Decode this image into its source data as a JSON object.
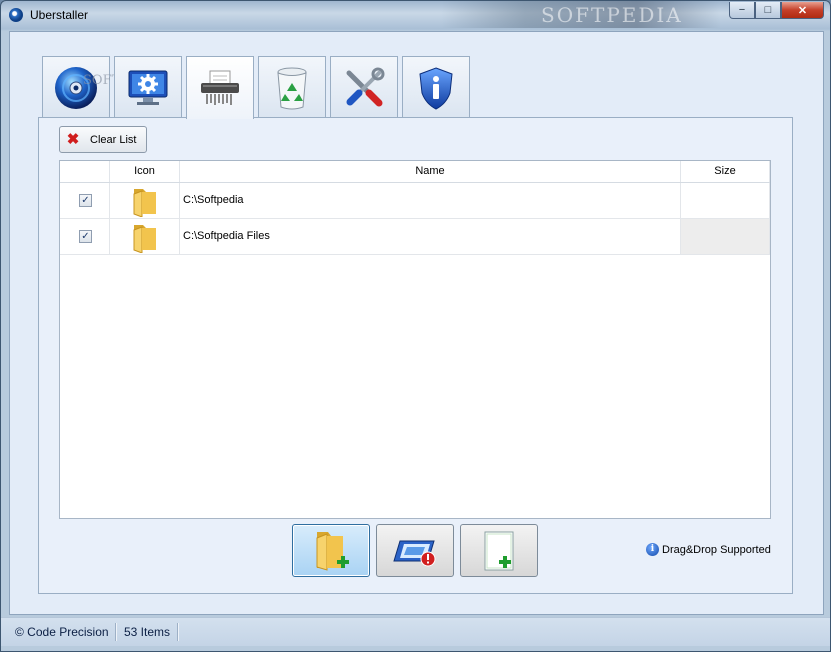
{
  "window": {
    "title": "Uberstaller",
    "watermark": "SOFTPEDIA",
    "tab_watermark": "SOFTPEDIA"
  },
  "caption_buttons": {
    "minimize": "−",
    "maximize": "□",
    "close": "✕"
  },
  "tabs": [
    {
      "name": "tab-disc",
      "icon": "disc-icon"
    },
    {
      "name": "tab-system",
      "icon": "monitor-gear-icon"
    },
    {
      "name": "tab-shredder",
      "icon": "shredder-icon",
      "active": true
    },
    {
      "name": "tab-recycle",
      "icon": "recycle-bin-icon"
    },
    {
      "name": "tab-tools",
      "icon": "tools-icon"
    },
    {
      "name": "tab-about",
      "icon": "info-shield-icon"
    }
  ],
  "toolbar": {
    "clear_label": "Clear List"
  },
  "table": {
    "columns": [
      "",
      "Icon",
      "Name",
      "Size"
    ],
    "rows": [
      {
        "checked": true,
        "check": "✓",
        "name": "C:\\Softpedia",
        "size": ""
      },
      {
        "checked": true,
        "check": "✓",
        "name": "C:\\Softpedia Files",
        "size": ""
      }
    ]
  },
  "bottom_buttons": [
    {
      "name": "add-folder-button",
      "icon": "folder-add-icon",
      "selected": true
    },
    {
      "name": "shred-button",
      "icon": "shred-warning-icon"
    },
    {
      "name": "add-file-button",
      "icon": "file-add-icon"
    }
  ],
  "hint": {
    "text": "Drag&Drop Supported",
    "icon_glyph": "i"
  },
  "statusbar": {
    "copyright": "© Code Precision",
    "items": "53 Items"
  },
  "colors": {
    "accent": "#2f6ea0",
    "close": "#c5402a",
    "client_bg": "#e3ecf8"
  }
}
